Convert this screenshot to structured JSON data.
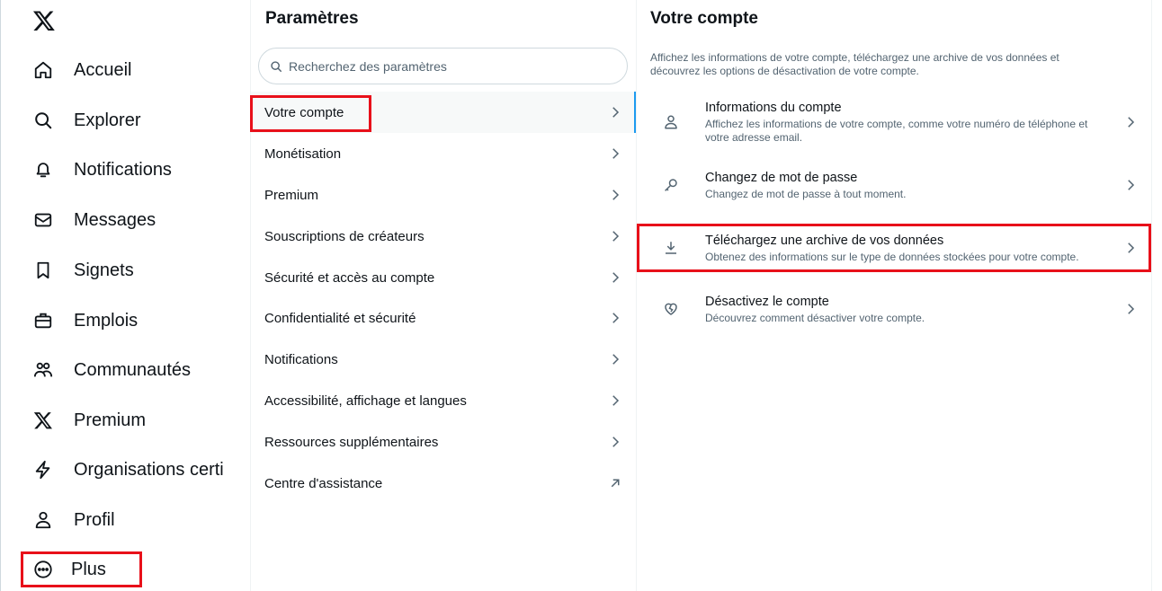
{
  "nav": {
    "logo_icon": "x-logo-icon",
    "items": [
      {
        "label": "Accueil",
        "icon": "home-icon"
      },
      {
        "label": "Explorer",
        "icon": "search-icon"
      },
      {
        "label": "Notifications",
        "icon": "bell-icon"
      },
      {
        "label": "Messages",
        "icon": "envelope-icon"
      },
      {
        "label": "Signets",
        "icon": "bookmark-icon"
      },
      {
        "label": "Emplois",
        "icon": "briefcase-icon"
      },
      {
        "label": "Communautés",
        "icon": "people-icon"
      },
      {
        "label": "Premium",
        "icon": "x-logo-icon"
      },
      {
        "label": "Organisations certi",
        "icon": "lightning-icon"
      },
      {
        "label": "Profil",
        "icon": "person-icon"
      },
      {
        "label": "Plus",
        "icon": "more-circle-icon"
      }
    ]
  },
  "settings": {
    "title": "Paramètres",
    "search_placeholder": "Recherchez des paramètres",
    "items": [
      {
        "label": "Votre compte",
        "icon": "chevron-right-icon",
        "active": true
      },
      {
        "label": "Monétisation",
        "icon": "chevron-right-icon"
      },
      {
        "label": "Premium",
        "icon": "chevron-right-icon"
      },
      {
        "label": "Souscriptions de créateurs",
        "icon": "chevron-right-icon"
      },
      {
        "label": "Sécurité et accès au compte",
        "icon": "chevron-right-icon"
      },
      {
        "label": "Confidentialité et sécurité",
        "icon": "chevron-right-icon"
      },
      {
        "label": "Notifications",
        "icon": "chevron-right-icon"
      },
      {
        "label": "Accessibilité, affichage et langues",
        "icon": "chevron-right-icon"
      },
      {
        "label": "Ressources supplémentaires",
        "icon": "chevron-right-icon"
      },
      {
        "label": "Centre d'assistance",
        "icon": "external-arrow-icon"
      }
    ]
  },
  "account": {
    "title": "Votre compte",
    "description": "Affichez les informations de votre compte, téléchargez une archive de vos données et découvrez les options de désactivation de votre compte.",
    "items": [
      {
        "title": "Informations du compte",
        "subtitle": "Affichez les informations de votre compte, comme votre numéro de téléphone et votre adresse email.",
        "icon": "person-icon"
      },
      {
        "title": "Changez de mot de passe",
        "subtitle": "Changez de mot de passe à tout moment.",
        "icon": "key-icon"
      },
      {
        "title": "Téléchargez une archive de vos données",
        "subtitle": "Obtenez des informations sur le type de données stockées pour votre compte.",
        "icon": "download-icon"
      },
      {
        "title": "Désactivez le compte",
        "subtitle": "Découvrez comment désactiver votre compte.",
        "icon": "broken-heart-icon"
      }
    ]
  },
  "colors": {
    "text": "#0f1419",
    "secondary_text": "#536471",
    "accent": "#1d9bf0",
    "highlight_box": "#e8101a"
  }
}
